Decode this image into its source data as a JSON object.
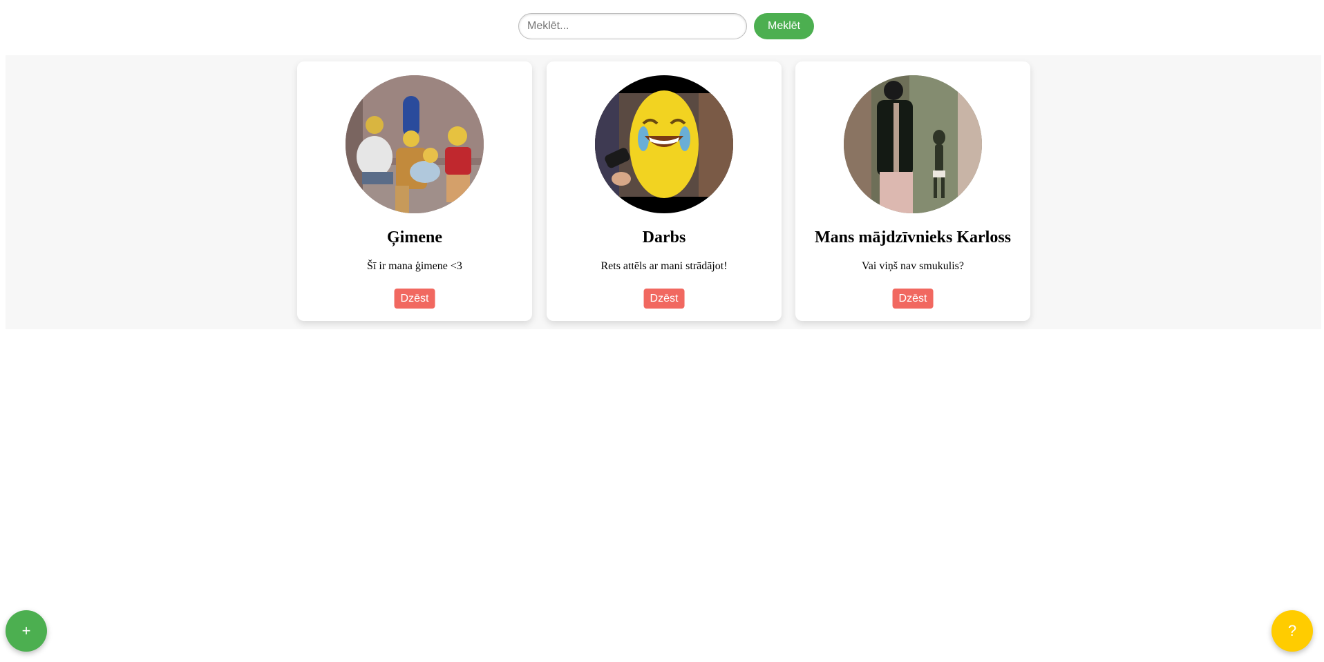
{
  "search": {
    "placeholder": "Meklēt...",
    "value": "",
    "button_label": "Meklēt"
  },
  "cards": [
    {
      "title": "Ģimene",
      "description": "Šī ir mana ģimene <3",
      "delete_label": "Dzēst"
    },
    {
      "title": "Darbs",
      "description": "Rets attēls ar mani strādājot!",
      "delete_label": "Dzēst"
    },
    {
      "title": "Mans mājdzīvnieks Karloss",
      "description": "Vai viņš nav smukulis?",
      "delete_label": "Dzēst"
    }
  ],
  "fab": {
    "add_label": "+",
    "help_label": "?"
  },
  "colors": {
    "accent_green": "#4caf50",
    "delete_red": "#f16860",
    "help_yellow": "#ffcc00",
    "gallery_bg": "#f7f7f7"
  }
}
